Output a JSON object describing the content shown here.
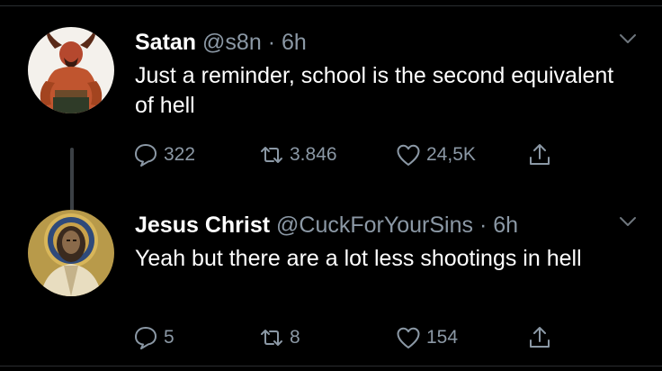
{
  "tweets": [
    {
      "name": "Satan",
      "handle": "@s8n",
      "separator": "·",
      "time": "6h",
      "text": "Just a reminder, school is the second equivalent of hell",
      "replies": "322",
      "retweets": "3.846",
      "likes": "24,5K",
      "avatar_icon": "devil-avatar-icon"
    },
    {
      "name": "Jesus Christ",
      "handle": "@CuckForYourSins",
      "separator": "·",
      "time": "6h",
      "text": "Yeah but there are a lot less shootings in hell",
      "replies": "5",
      "retweets": "8",
      "likes": "154",
      "avatar_icon": "jesus-mosaic-avatar-icon"
    }
  ],
  "colors": {
    "background": "#000000",
    "text": "#ffffff",
    "muted": "#8b98a5",
    "thread_line": "#3b4045"
  }
}
